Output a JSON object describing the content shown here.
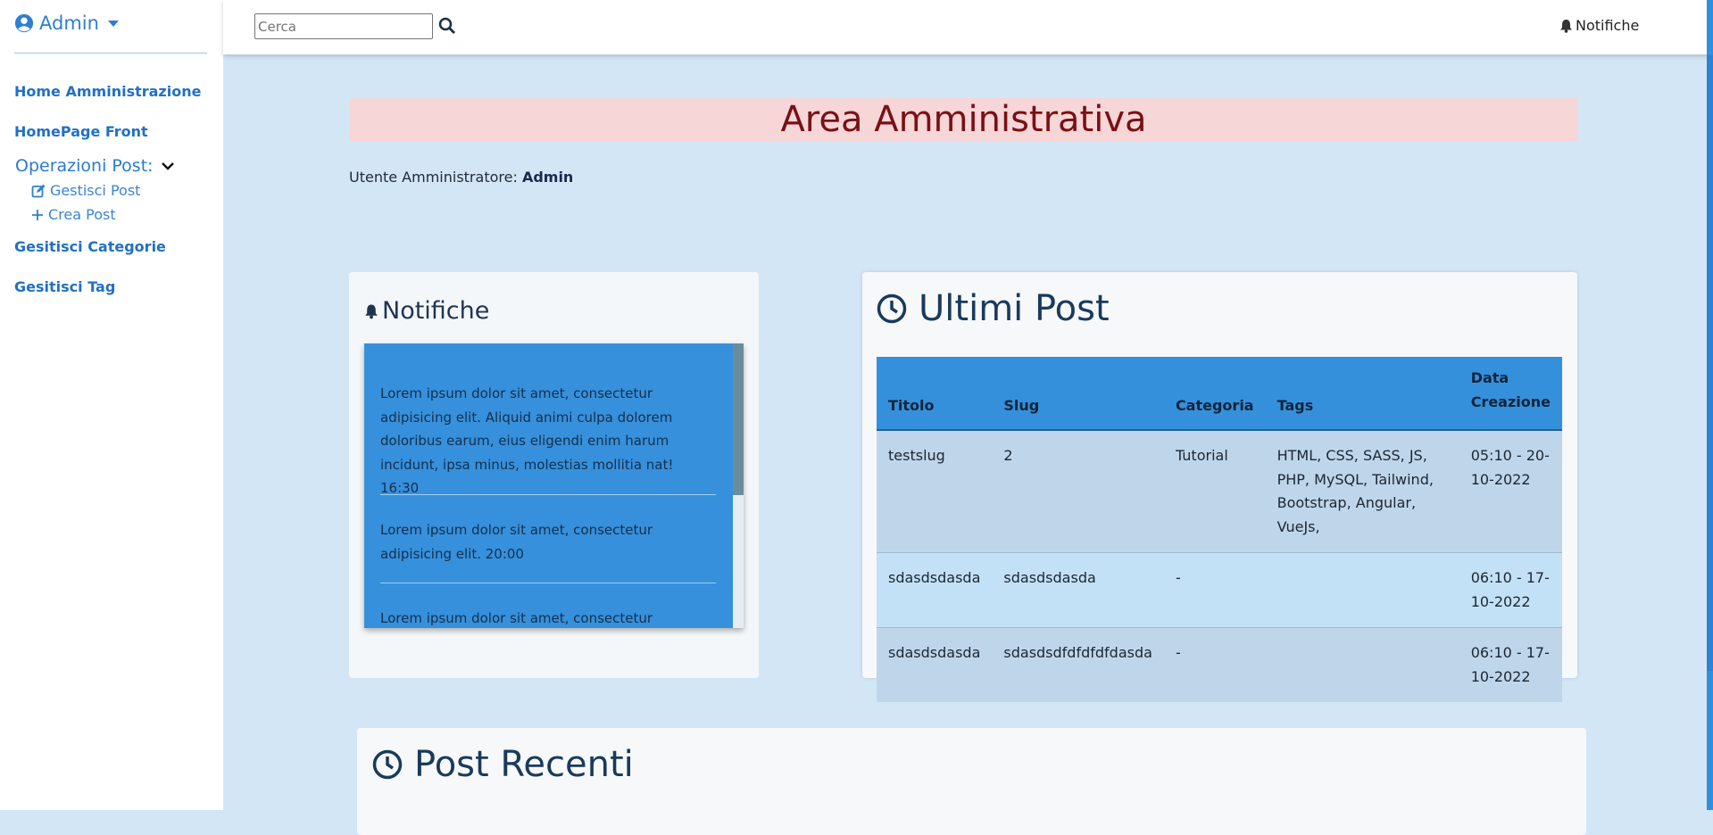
{
  "sidebar": {
    "user_label": "Admin",
    "items": [
      {
        "label": "Home Amministrazione"
      },
      {
        "label": "HomePage Front"
      },
      {
        "label": "Gesitisci Categorie"
      },
      {
        "label": "Gesitisci Tag"
      }
    ],
    "operations": {
      "label": "Operazioni Post:",
      "subitems": [
        {
          "label": "Gestisci Post",
          "icon": "edit-icon"
        },
        {
          "label": "Crea Post",
          "icon": "plus-icon"
        }
      ]
    }
  },
  "topbar": {
    "search_placeholder": "Cerca",
    "notifications_label": "Notifiche"
  },
  "banner": {
    "title": "Area Amministrativa"
  },
  "admin_line": {
    "prefix": "Utente Amministratore:",
    "name": "Admin"
  },
  "notifications_panel": {
    "title": "Notifiche",
    "items": [
      "Lorem ipsum dolor sit amet, consectetur adipisicing elit. Aliquid animi culpa dolorem doloribus earum, eius eligendi enim harum incidunt, ipsa minus, molestias mollitia nat! 16:30",
      "Lorem ipsum dolor sit amet, consectetur adipisicing elit. 20:00",
      "Lorem ipsum dolor sit amet, consectetur"
    ]
  },
  "latest_posts": {
    "title": "Ultimi Post",
    "columns": [
      "Titolo",
      "Slug",
      "Categoria",
      "Tags",
      "Data Creazione"
    ],
    "rows": [
      {
        "titolo": "testslug",
        "slug": "2",
        "categoria": "Tutorial",
        "tags": "HTML, CSS, SASS, JS, PHP, MySQL, Tailwind, Bootstrap, Angular, VueJs,",
        "data": "05:10 - 20-10-2022"
      },
      {
        "titolo": "sdasdsdasda",
        "slug": "sdasdsdasda",
        "categoria": "-",
        "tags": "",
        "data": "06:10 - 17-10-2022"
      },
      {
        "titolo": "sdasdsdasda",
        "slug": "sdasdsdfdfdfdfdasda",
        "categoria": "-",
        "tags": "",
        "data": "06:10 - 17-10-2022"
      }
    ]
  },
  "recent_posts": {
    "title": "Post Recenti"
  },
  "colors": {
    "accent": "#3590dc",
    "background": "#d3e6f6",
    "banner_bg": "#f7d6d8",
    "banner_text": "#7a1014"
  }
}
